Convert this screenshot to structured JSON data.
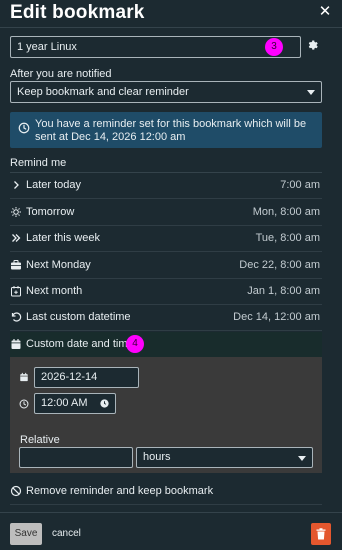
{
  "header": {
    "title": "Edit bookmark",
    "close_glyph": "✕"
  },
  "name_input": {
    "value": "1 year Linux",
    "callout": "3"
  },
  "notify": {
    "label": "After you are notified",
    "selected": "Keep bookmark and clear reminder"
  },
  "info": {
    "text": "You have a reminder set for this bookmark which will be sent at Dec 14, 2026 12:00 am"
  },
  "remind": {
    "label": "Remind me",
    "options": [
      {
        "label": "Later today",
        "value": "7:00 am",
        "icon": "chevron-right-icon"
      },
      {
        "label": "Tomorrow",
        "value": "Mon, 8:00 am",
        "icon": "sun-icon"
      },
      {
        "label": "Later this week",
        "value": "Tue, 8:00 am",
        "icon": "double-chevron-icon"
      },
      {
        "label": "Next Monday",
        "value": "Dec 22, 8:00 am",
        "icon": "briefcase-icon"
      },
      {
        "label": "Next month",
        "value": "Jan 1, 8:00 am",
        "icon": "calendar-plus-icon"
      },
      {
        "label": "Last custom datetime",
        "value": "Dec 14, 12:00 am",
        "icon": "undo-icon"
      }
    ],
    "custom": {
      "label": "Custom date and time",
      "callout": "4"
    }
  },
  "custom_panel": {
    "date": "2026-12-14",
    "time": "12:00 AM",
    "relative_label": "Relative",
    "relative_value": "",
    "relative_unit": "hours"
  },
  "remove": {
    "label": "Remove reminder and keep bookmark"
  },
  "footer": {
    "save": "Save",
    "cancel": "cancel"
  },
  "colors": {
    "background": "#1c2a31",
    "info_bg": "#1f4c68",
    "callout": "#ff00ff",
    "danger": "#e4572e"
  }
}
